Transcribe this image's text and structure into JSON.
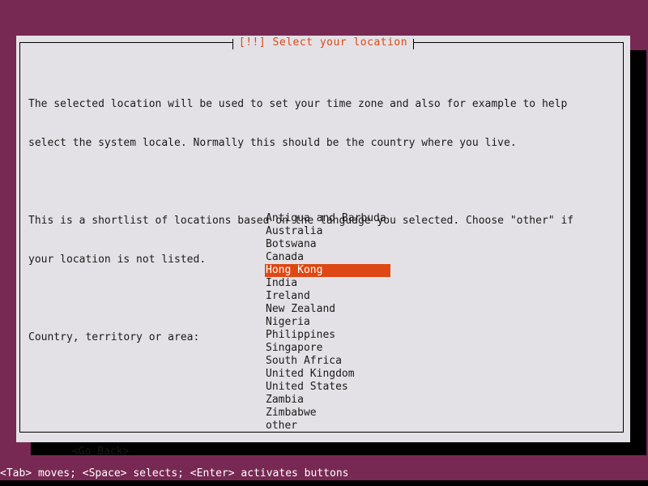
{
  "dialog": {
    "title": "[!!] Select your location",
    "paragraphs": [
      [
        "The selected location will be used to set your time zone and also for example to help",
        "select the system locale. Normally this should be the country where you live."
      ],
      [
        "This is a shortlist of locations based on the language you selected. Choose \"other\" if",
        "your location is not listed."
      ]
    ],
    "list_label": "Country, territory or area:",
    "countries": [
      "Antigua and Barbuda",
      "Australia",
      "Botswana",
      "Canada",
      "Hong Kong",
      "India",
      "Ireland",
      "New Zealand",
      "Nigeria",
      "Philippines",
      "Singapore",
      "South Africa",
      "United Kingdom",
      "United States",
      "Zambia",
      "Zimbabwe",
      "other"
    ],
    "selected_country": "Hong Kong",
    "selected_index": 4,
    "go_back_label": "<Go Back>"
  },
  "status_bar": {
    "text": "<Tab> moves; <Space> selects; <Enter> activates buttons"
  },
  "colors": {
    "backdrop": "#772953",
    "panel": "#e4e1e6",
    "accent": "#dd4814",
    "text": "#1a1a1a",
    "shadow": "#000000",
    "selected_text": "#ffffff"
  }
}
